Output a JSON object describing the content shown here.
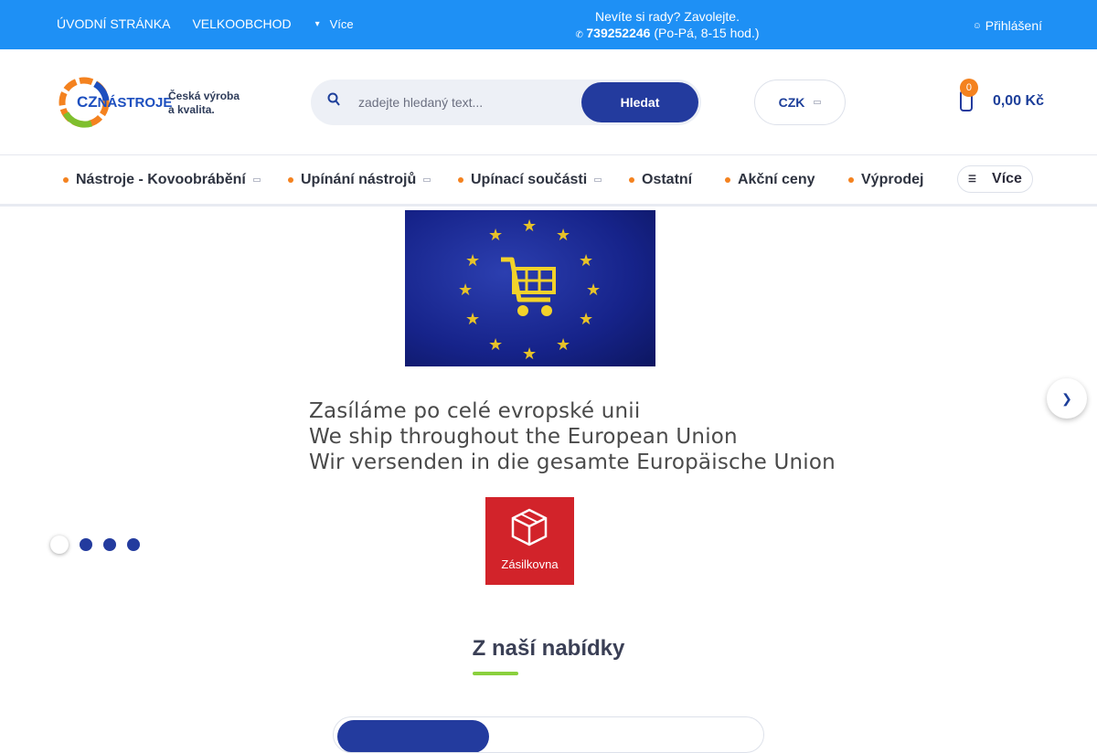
{
  "topbar": {
    "nav": [
      "ÚVODNÍ STRÁNKA",
      "VELKOOBCHOD"
    ],
    "more_label": "Více",
    "help_text": "Nevíte si rady? Zavolejte.",
    "phone": "739252246",
    "hours": "(Po-Pá, 8-15 hod.)",
    "login_label": "Přihlášení"
  },
  "header": {
    "logo_cz": "CZ",
    "logo_name": "NÁSTROJE",
    "slogan_line1": "Česká výroba",
    "slogan_line2": "a kvalita.",
    "search_placeholder": "zadejte hledaný text...",
    "search_button": "Hledat",
    "currency": "CZK",
    "cart_count": "0",
    "cart_total": "0,00 Kč"
  },
  "menu": {
    "items": [
      "Nástroje - Kovoobrábění",
      "Upínání nástrojů",
      "Upínací součásti",
      "Ostatní",
      "Akční ceny",
      "Výprodej"
    ],
    "more_label": "Více"
  },
  "banner": {
    "ship_lines": [
      "Zasíláme po celé evropské unii",
      "We ship throughout the European Union",
      "Wir versenden in die gesamte Europäische Union"
    ],
    "carrier": "Zásilkovna",
    "slide_count": 4,
    "active_slide": 1
  },
  "section": {
    "title": "Z naší nabídky"
  },
  "colors": {
    "topbar": "#1e90f5",
    "primary": "#233b9e",
    "accent": "#f4821f",
    "underline": "#8ad03d"
  },
  "icons": [
    "chevron-down-icon",
    "phone-icon",
    "user-icon",
    "search-icon",
    "cart-icon",
    "arrow-right-icon"
  ]
}
